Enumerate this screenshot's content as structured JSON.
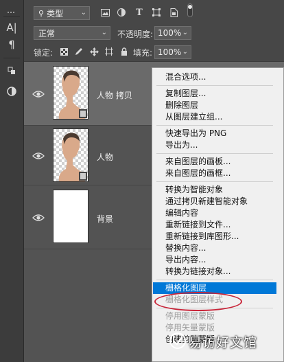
{
  "toolbar_left": {
    "tools": [
      "character-panel-icon",
      "paragraph-panel-icon",
      "3d-panel-icon",
      "adjustments-icon"
    ],
    "text_tool_glyph": "A|",
    "paragraph_glyph": "¶"
  },
  "filter_row": {
    "filter_type": "类型",
    "filter_icons": [
      "pixel-filter-icon",
      "adjustment-filter-icon",
      "type-filter-icon",
      "shape-filter-icon",
      "smart-object-filter-icon",
      "filter-toggle-icon"
    ],
    "type_glyph": "T"
  },
  "blend_row": {
    "blend_mode": "正常",
    "opacity_label": "不透明度:",
    "opacity_value": "100%"
  },
  "lock_row": {
    "lock_label": "锁定:",
    "lock_icons": [
      "lock-transparent-icon",
      "lock-image-icon",
      "lock-position-icon",
      "lock-artboard-icon",
      "lock-all-icon"
    ],
    "fill_label": "填充:",
    "fill_value": "100%"
  },
  "layers": [
    {
      "name": "人物 拷贝",
      "selected": true,
      "type": "transparent-portrait"
    },
    {
      "name": "人物",
      "selected": false,
      "type": "transparent-portrait"
    },
    {
      "name": "背景",
      "selected": false,
      "type": "white"
    }
  ],
  "context_menu": {
    "items": [
      {
        "label": "混合选项...",
        "disabled": false
      },
      {
        "sep": true
      },
      {
        "label": "复制图层...",
        "disabled": false
      },
      {
        "label": "删除图层",
        "disabled": false
      },
      {
        "label": "从图层建立组...",
        "disabled": false
      },
      {
        "sep": true
      },
      {
        "label": "快速导出为 PNG",
        "disabled": false
      },
      {
        "label": "导出为...",
        "disabled": false
      },
      {
        "sep": true
      },
      {
        "label": "来自图层的画板...",
        "disabled": false
      },
      {
        "label": "来自图层的画框...",
        "disabled": false
      },
      {
        "sep": true
      },
      {
        "label": "转换为智能对象",
        "disabled": false
      },
      {
        "label": "通过拷贝新建智能对象",
        "disabled": false
      },
      {
        "label": "编辑内容",
        "disabled": false
      },
      {
        "label": "重新链接到文件...",
        "disabled": false
      },
      {
        "label": "重新链接到库图形...",
        "disabled": false
      },
      {
        "label": "替换内容...",
        "disabled": false
      },
      {
        "label": "导出内容...",
        "disabled": false
      },
      {
        "label": "转换为链接对象...",
        "disabled": false
      },
      {
        "sep": true
      },
      {
        "label": "栅格化图层",
        "disabled": false,
        "highlighted": true
      },
      {
        "label": "栅格化图层样式",
        "disabled": true
      },
      {
        "sep": true
      },
      {
        "label": "停用图层蒙版",
        "disabled": true
      },
      {
        "label": "停用矢量蒙版",
        "disabled": true
      },
      {
        "label": "创建剪贴蒙版",
        "disabled": false
      }
    ]
  },
  "watermark": {
    "text": "易访好文馆"
  },
  "colors": {
    "menu_highlight": "#0078d7",
    "annotation_circle": "#c9263a",
    "panel_bg": "#535353",
    "selected_layer_bg": "#6a6a6a"
  }
}
